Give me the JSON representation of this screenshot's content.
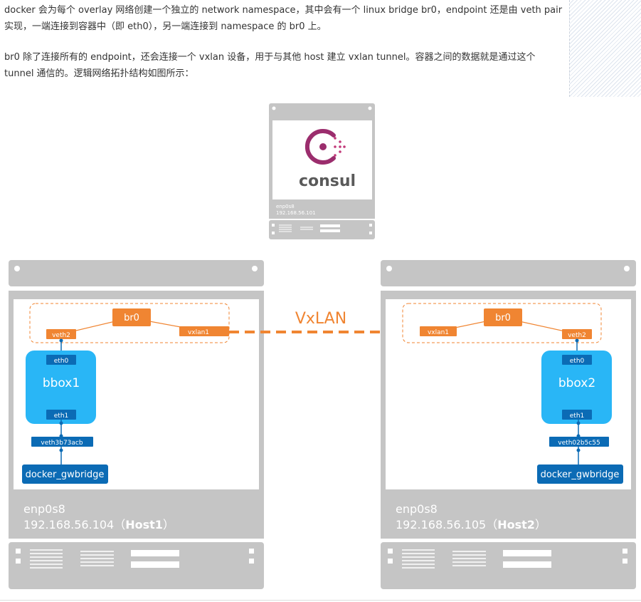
{
  "paragraphs": [
    "docker 会为每个 overlay 网络创建一个独立的 network namespace，其中会有一个 linux bridge br0，endpoint 还是由 veth pair 实现，一端连接到容器中（即 eth0），另一端连接到 namespace 的 br0 上。",
    "br0 除了连接所有的 endpoint，还会连接一个 vxlan 设备，用于与其他 host 建立 vxlan tunnel。容器之间的数据就是通过这个 tunnel 通信的。逻辑网络拓扑结构如图所示："
  ],
  "consul": {
    "logo_text": "consul",
    "iface": "enp0s8",
    "ip": "192.168.56.101"
  },
  "tunnel_label": "VxLAN",
  "host1": {
    "bridge": "br0",
    "veth": "veth2",
    "vxlan": "vxlan1",
    "container": "bbox1",
    "eth0": "eth0",
    "eth1": "eth1",
    "gw_veth": "veth3b73acb",
    "gwbridge": "docker_gwbridge",
    "iface": "enp0s8",
    "ip": "192.168.56.104（",
    "host": "Host1",
    "close": "）"
  },
  "host2": {
    "bridge": "br0",
    "veth": "veth2",
    "vxlan": "vxlan1",
    "container": "bbox2",
    "eth0": "eth0",
    "eth1": "eth1",
    "gw_veth": "veth02b5c55",
    "gwbridge": "docker_gwbridge",
    "iface": "enp0s8",
    "ip": "192.168.56.105（",
    "host": "Host2",
    "close": "）"
  },
  "colors": {
    "orange": "#f08532",
    "container_blue": "#29b6f6",
    "tag_blue": "#0b6bb5",
    "server_gray": "#c5c5c5"
  }
}
